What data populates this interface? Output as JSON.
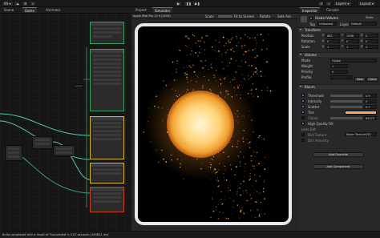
{
  "toolbar": {
    "account_label": "AS",
    "cloud_label": "",
    "layers_label": "Layers",
    "layout_label": "Layout"
  },
  "left_panel": {
    "tabs": [
      "Scene",
      "Game",
      "Animator"
    ],
    "active_tab": 1
  },
  "center_panel": {
    "tabs": [
      "Project",
      "Simulator"
    ],
    "active_tab": 1,
    "device_label": "Simulator",
    "device_model": "Apple iPad Pro 12.9 (2018)",
    "scale_label": "Scale",
    "fit_label": "Fit to Screen",
    "rotate_label": "Rotate",
    "safe_area_label": "Safe Are"
  },
  "right_panel": {
    "tabs": [
      "Inspector",
      "Console"
    ],
    "active_tab": 0,
    "object_name": "Global Volume",
    "static_label": "Static",
    "tag_label": "Tag",
    "tag_value": "Untagged",
    "layer_label": "Layer",
    "layer_value": "Default",
    "transform_header": "Transform",
    "transform_rows": [
      {
        "label": "Position",
        "values": [
          "X",
          "882",
          "Y",
          "1098",
          "Z",
          "0"
        ]
      },
      {
        "label": "Rotation",
        "values": [
          "X",
          "0",
          "Y",
          "0",
          "Z",
          "0"
        ]
      },
      {
        "label": "Scale",
        "values": [
          "X",
          "1",
          "Y",
          "1",
          "Z",
          "1"
        ]
      }
    ],
    "volume_header": "Volume",
    "volume_rows": [
      {
        "label": "Mode",
        "value": "Global"
      },
      {
        "label": "Weight",
        "value": "1"
      },
      {
        "label": "Priority",
        "value": "0"
      },
      {
        "label": "Profile",
        "value": ""
      }
    ],
    "new_label": "New",
    "clone_label": "Clone",
    "bloom_header": "Bloom",
    "bloom_rows": [
      {
        "label": "Threshold",
        "value": "0.9",
        "checked": true
      },
      {
        "label": "Intensity",
        "value": "5",
        "checked": true
      },
      {
        "label": "Scatter",
        "value": "0.7",
        "checked": true
      },
      {
        "label": "Tint",
        "value": "",
        "checked": true
      },
      {
        "label": "Clamp",
        "value": "65472",
        "checked": false
      }
    ],
    "hq_label": "High Quality Filt",
    "lens_dirt_label": "Lens Dirt",
    "dirt_texture_label": "Dirt Texture",
    "dirt_texture_value": "None (Texture2D)",
    "dirt_intensity_label": "Dirt Intensity",
    "add_override_label": "Add Override",
    "add_component_label": "Add Component",
    "tint_color": "#f8a868"
  },
  "status": {
    "message": "Build completed with a result of 'Succeeded' in 147 seconds (149821 ms)"
  },
  "colors": {
    "accent": "#3b6fba",
    "node_green": "#3aa25a",
    "node_yellow": "#d8b620",
    "node_red": "#c8402e",
    "wire_teal": "#4ec7b3",
    "device_frame": "#e9e9e9",
    "particle": "#ffb040"
  }
}
